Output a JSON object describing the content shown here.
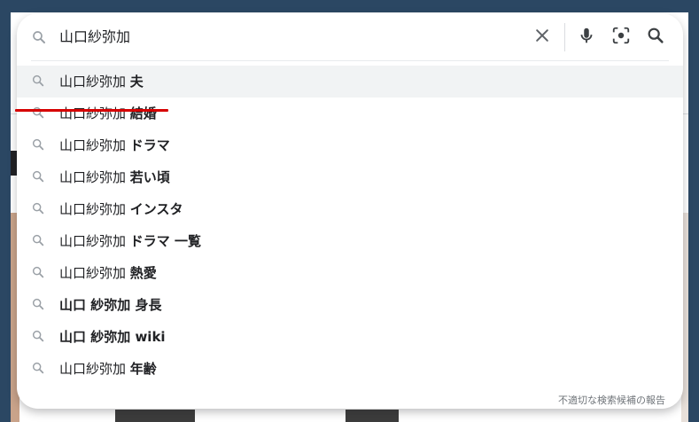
{
  "search": {
    "query": "山口紗弥加",
    "icons": {
      "leading": "search-icon",
      "clear": "close-icon",
      "voice": "microphone-icon",
      "lens": "camera-lens-icon",
      "submit": "search-icon"
    }
  },
  "suggestions": [
    {
      "prefix": "山口紗弥加 ",
      "bold": "夫",
      "highlighted": true
    },
    {
      "prefix": "山口紗弥加 ",
      "bold": "結婚",
      "highlighted": false
    },
    {
      "prefix": "山口紗弥加 ",
      "bold": "ドラマ",
      "highlighted": false
    },
    {
      "prefix": "山口紗弥加 ",
      "bold": "若い頃",
      "highlighted": false
    },
    {
      "prefix": "山口紗弥加 ",
      "bold": "インスタ",
      "highlighted": false
    },
    {
      "prefix": "山口紗弥加 ",
      "bold": "ドラマ 一覧",
      "highlighted": false
    },
    {
      "prefix": "山口紗弥加 ",
      "bold": "熱愛",
      "highlighted": false
    },
    {
      "prefix": "",
      "bold": "山口 紗弥加 身長",
      "highlighted": false
    },
    {
      "prefix": "",
      "bold": "山口 紗弥加 wiki",
      "highlighted": false
    },
    {
      "prefix": "山口紗弥加 ",
      "bold": "年齢",
      "highlighted": false
    }
  ],
  "report_link": "不適切な検索候補の報告",
  "colors": {
    "annotation_underline": "#d60000",
    "highlight_row": "#f1f3f4",
    "icon_gray": "#5f6368",
    "text": "#202124"
  }
}
